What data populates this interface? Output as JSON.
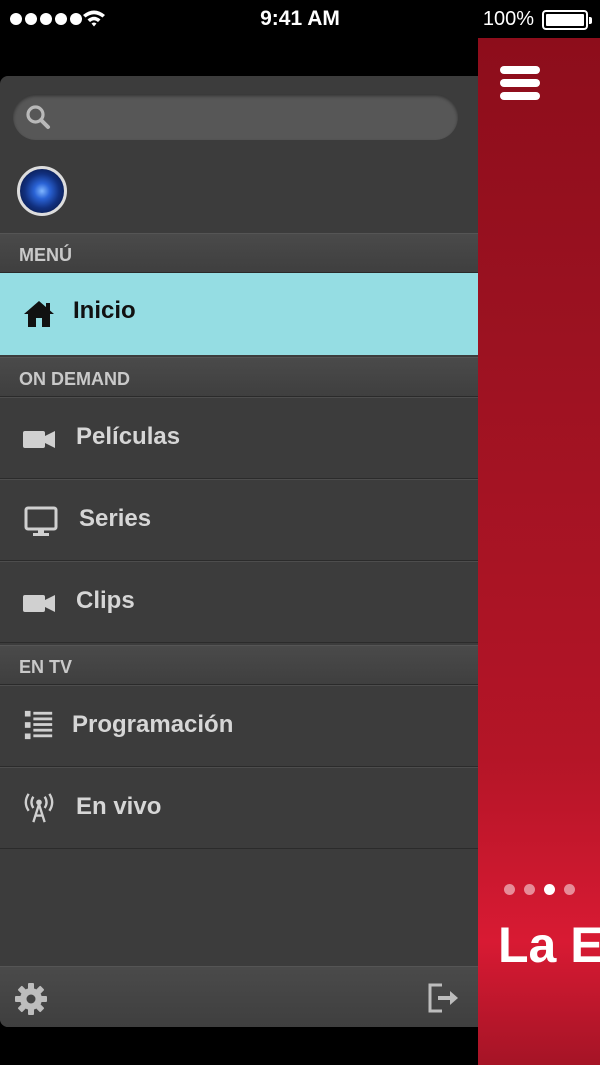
{
  "status_bar": {
    "time": "9:41 AM",
    "battery": "100%",
    "icons": [
      "signal-dots-icon",
      "wifi-icon",
      "battery-icon"
    ]
  },
  "drawer": {
    "search": {
      "placeholder": "",
      "value": ""
    },
    "sections": [
      {
        "header": "MENÚ",
        "items": [
          {
            "label": "Inicio",
            "icon": "home-icon",
            "active": true
          }
        ]
      },
      {
        "header": "ON DEMAND",
        "items": [
          {
            "label": "Películas",
            "icon": "video-camera-icon"
          },
          {
            "label": "Series",
            "icon": "monitor-icon"
          },
          {
            "label": "Clips",
            "icon": "video-camera-icon"
          }
        ]
      },
      {
        "header": "EN TV",
        "items": [
          {
            "label": "Programación",
            "icon": "list-icon"
          },
          {
            "label": "En vivo",
            "icon": "broadcast-antenna-icon"
          }
        ]
      }
    ],
    "footer_icons": [
      "gear-icon",
      "logout-icon"
    ]
  },
  "main": {
    "hero_title": "La E",
    "carousel": {
      "pages": 4,
      "active_index": 2
    }
  },
  "colors": {
    "drawer_bg": "#3c3c3c",
    "active_item_bg": "#95dde3",
    "main_bg": "#a51426"
  }
}
